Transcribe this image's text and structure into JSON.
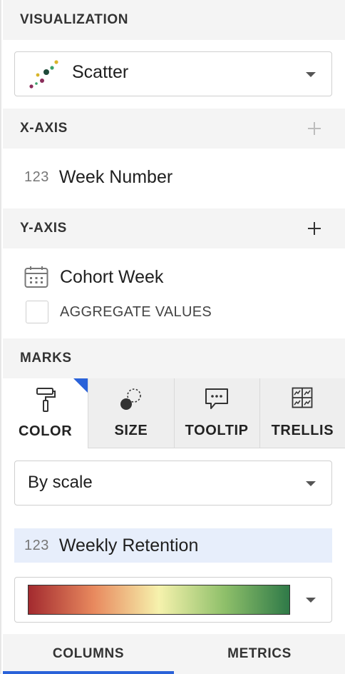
{
  "visualization": {
    "header": "VISUALIZATION",
    "type_label": "Scatter",
    "icon": "scatter-chart-icon"
  },
  "x_axis": {
    "header": "X-AXIS",
    "field_type": "123",
    "field_label": "Week Number"
  },
  "y_axis": {
    "header": "Y-AXIS",
    "field_label": "Cohort Week",
    "field_icon": "calendar-icon",
    "aggregate_label": "AGGREGATE VALUES",
    "aggregate_checked": false
  },
  "marks": {
    "header": "MARKS",
    "tabs": [
      {
        "label": "COLOR",
        "icon": "paint-roller-icon",
        "active": true
      },
      {
        "label": "SIZE",
        "icon": "size-circles-icon",
        "active": false
      },
      {
        "label": "TOOLTIP",
        "icon": "tooltip-bubble-icon",
        "active": false
      },
      {
        "label": "TRELLIS",
        "icon": "trellis-grid-icon",
        "active": false
      }
    ],
    "color_mode": "By scale",
    "color_field_type": "123",
    "color_field_label": "Weekly Retention",
    "gradient_colors": [
      "#a32a2f",
      "#e8895e",
      "#f6f2ad",
      "#8fc06a",
      "#2f7a48"
    ]
  },
  "bottom_tabs": [
    {
      "label": "COLUMNS",
      "active": true
    },
    {
      "label": "METRICS",
      "active": false
    }
  ],
  "colors": {
    "accent": "#2a62d9",
    "highlight_row": "#e7eefb"
  }
}
